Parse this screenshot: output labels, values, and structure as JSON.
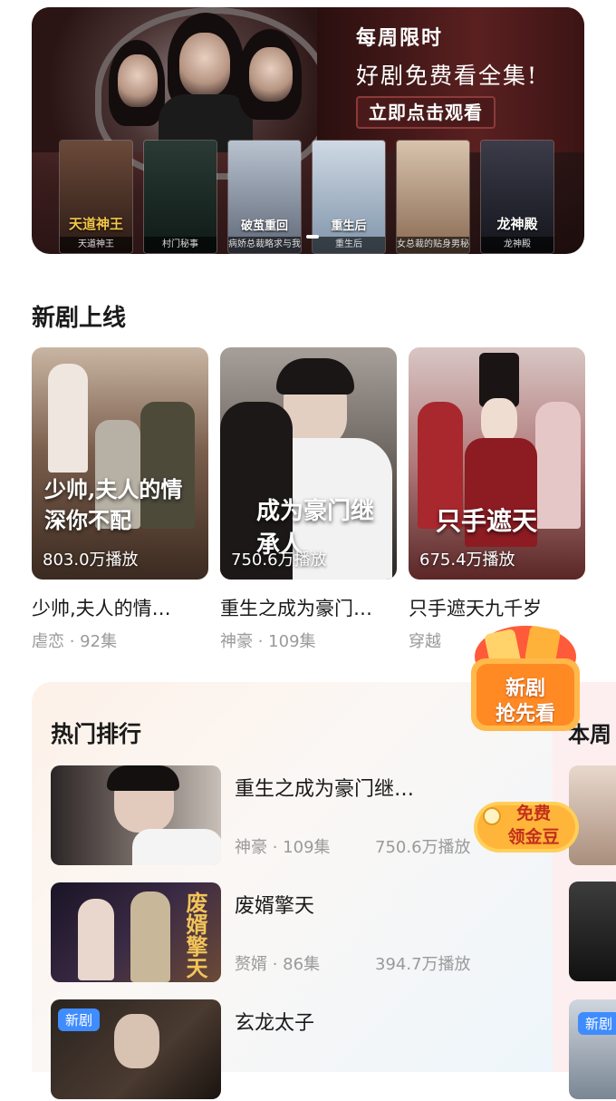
{
  "banner": {
    "tag": "每周限时",
    "title": "好剧免费看全集!",
    "cta": "立即点击观看",
    "mini_posters": [
      {
        "logo": "天道神王",
        "caption": "天道神王"
      },
      {
        "logo": "",
        "caption": "村门秘事"
      },
      {
        "logo": "破茧重回",
        "caption": "病娇总裁略求与我"
      },
      {
        "logo": "重生后",
        "caption": "重生后"
      },
      {
        "logo": "",
        "caption": "女总裁的贴身男秘"
      },
      {
        "logo": "龙神殿",
        "caption": "龙神殿"
      }
    ]
  },
  "new_section": {
    "title": "新剧上线",
    "cards": [
      {
        "cover_text": "少帅,夫人的情深你不配",
        "plays": "803.0万播放",
        "name": "少帅,夫人的情…",
        "genre": "虐恋",
        "episodes": "92集"
      },
      {
        "cover_text": "成为豪门继承人",
        "plays": "750.6万播放",
        "name": "重生之成为豪门…",
        "genre": "神豪",
        "episodes": "109集"
      },
      {
        "cover_text": "只手遮天",
        "plays": "675.4万播放",
        "name": "只手遮天九千岁",
        "genre": "穿越",
        "episodes": ""
      }
    ]
  },
  "ranking": {
    "title": "热门排行",
    "items": [
      {
        "title": "重生之成为豪门继…",
        "genre": "神豪",
        "episodes": "109集",
        "plays": "750.6万播放",
        "badge": ""
      },
      {
        "title": "废婿擎天",
        "genre": "赘婿",
        "episodes": "86集",
        "plays": "394.7万播放",
        "badge": ""
      },
      {
        "title": "玄龙太子",
        "genre": "",
        "episodes": "",
        "plays": "",
        "badge": "新剧"
      }
    ]
  },
  "side_panel": {
    "title": "本周",
    "badge": "新剧"
  },
  "floating": {
    "bag_text_line1": "新剧",
    "bag_text_line2": "抢先看",
    "coin_text_line1": "免费",
    "coin_text_line2": "领金豆"
  },
  "separator": " · "
}
